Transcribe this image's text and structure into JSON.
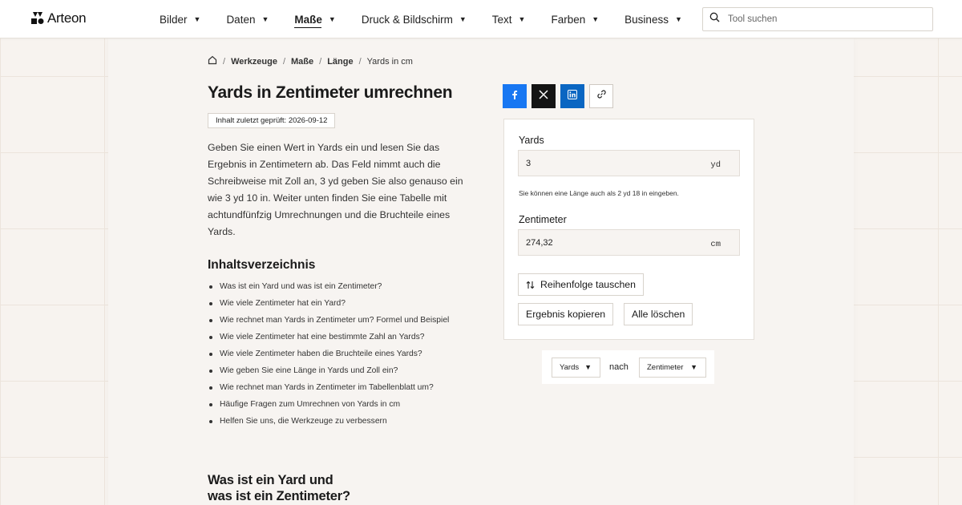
{
  "brand": {
    "name": "Arteon"
  },
  "nav": {
    "items": [
      {
        "label": "Bilder",
        "active": false
      },
      {
        "label": "Daten",
        "active": false
      },
      {
        "label": "Maße",
        "active": true
      },
      {
        "label": "Druck & Bildschirm",
        "active": false
      },
      {
        "label": "Text",
        "active": false
      },
      {
        "label": "Farben",
        "active": false
      },
      {
        "label": "Business",
        "active": false
      }
    ]
  },
  "search": {
    "placeholder": "Tool suchen"
  },
  "breadcrumb": {
    "home_icon": "home-icon",
    "items": [
      "Werkzeuge",
      "Maße",
      "Länge",
      "Yards in cm"
    ]
  },
  "page": {
    "title": "Yards in Zentimeter umrechnen",
    "updated": "Inhalt zuletzt geprüft: 2026-09-12",
    "intro": "Geben Sie einen Wert in Yards ein und lesen Sie das Ergebnis in Zentimetern ab. Das Feld nimmt auch die Schreibweise mit Zoll an, 3 yd geben Sie also genauso ein wie 3 yd 10 in. Weiter unten finden Sie eine Tabelle mit achtundfünfzig Umrechnungen und die Bruchteile eines Yards.",
    "toc_title": "Inhaltsverzeichnis",
    "toc": [
      "Was ist ein Yard und was ist ein Zentimeter?",
      "Wie viele Zentimeter hat ein Yard?",
      "Wie rechnet man Yards in Zentimeter um? Formel und Beispiel",
      "Wie viele Zentimeter hat eine bestimmte Zahl an Yards?",
      "Wie viele Zentimeter haben die Bruchteile eines Yards?",
      "Wie geben Sie eine Länge in Yards und Zoll ein?",
      "Wie rechnet man Yards in Zentimeter im Tabellenblatt um?",
      "Häufige Fragen zum Umrechnen von Yards in cm",
      "Helfen Sie uns, die Werkzeuge zu verbessern"
    ],
    "section_heading_line1": "Was ist ein Yard und",
    "section_heading_line2": "was ist ein Zentimeter?"
  },
  "share": {
    "icons": [
      "facebook-icon",
      "x-icon",
      "linkedin-icon",
      "link-icon"
    ],
    "colors": {
      "facebook": "#1877f2",
      "x": "#141414",
      "linkedin": "#0a66c2"
    }
  },
  "converter": {
    "from_label": "Yards",
    "from_value": "3",
    "from_unit": "yd",
    "hint": "Sie können eine Länge auch als 2 yd 18 in eingeben.",
    "to_label": "Zentimeter",
    "to_value": "274,32",
    "to_unit": "cm",
    "swap_label": "Reihenfolge tauschen",
    "copy_label": "Ergebnis kopieren",
    "clear_label": "Alle löschen"
  },
  "unit_select": {
    "from": "Yards",
    "connector": "nach",
    "to": "Zentimeter"
  }
}
